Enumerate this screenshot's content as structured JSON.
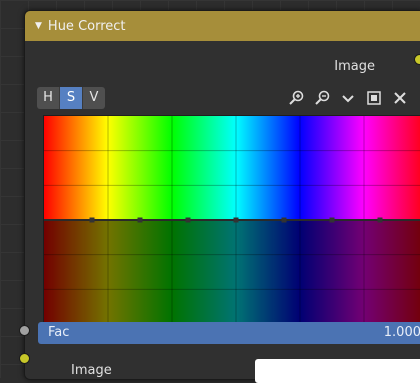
{
  "node": {
    "title": "Hue Correct",
    "output_label": "Image",
    "channels": [
      "H",
      "S",
      "V"
    ],
    "active_channel": "S",
    "tools": [
      "zoom-in-icon",
      "zoom-out-icon",
      "chevron-down-icon",
      "clip-icon",
      "close-icon"
    ]
  },
  "curve": {
    "control_points": 7,
    "level": 0.5
  },
  "fac": {
    "label": "Fac",
    "value": "1.000"
  },
  "image_input": {
    "label": "Image",
    "color": "#ffffff"
  },
  "colors": {
    "header": "#a68e3a",
    "active_button": "#5680c2",
    "fac_bar": "#4b73b3",
    "socket_image": "#c7c729",
    "socket_value": "#a1a1a1"
  }
}
